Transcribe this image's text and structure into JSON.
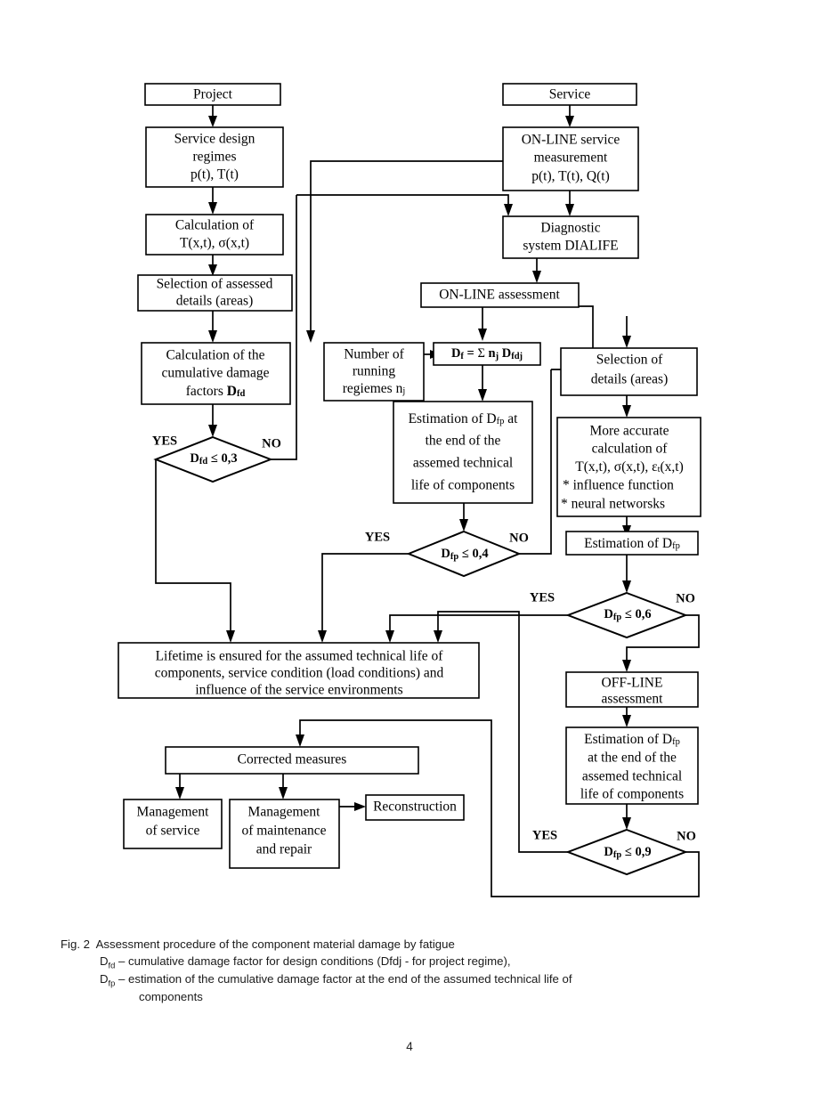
{
  "figure": {
    "page_number": "4",
    "caption_prefix": "Fig. 2",
    "caption_title": "Assessment procedure of the component material damage by fatigue",
    "legend_line_1_symbol": "Dfd",
    "legend_line_1_text": "– cumulative damage factor for design conditions (Dfdj - for project regime),",
    "legend_line_2_symbol": "Dfp",
    "legend_line_2_text": "– estimation of the cumulative damage factor at the end of the assumed technical life of",
    "legend_line_2_cont": "components"
  },
  "nodes": {
    "project": "Project",
    "service": "Service",
    "service_design_regimes_l1": "Service design",
    "service_design_regimes_l2": "regimes",
    "service_design_regimes_l3": "p(t), T(t)",
    "online_measurement_l1": "ON-LINE service",
    "online_measurement_l2": "measurement",
    "online_measurement_l3": "p(t), T(t), Q(t)",
    "calculation_l1": "Calculation of",
    "calculation_l2": "T(x,t), σ(x,t)",
    "diagnostic_l1": "Diagnostic",
    "diagnostic_l2": "system DIALIFE",
    "selection_assessed_l1": "Selection of assessed",
    "selection_assessed_l2": "details (areas)",
    "online_assessment": "ON-LINE assessment",
    "cumulative_l1": "Calculation of the",
    "cumulative_l2": "cumulative damage",
    "cumulative_l3": "factors",
    "cumulative_l3_sym": "Dfd",
    "running_regimes_l1": "Number of",
    "running_regimes_l2": "running",
    "running_regimes_l3": "regiemes",
    "running_regimes_l3_sym": "nj",
    "df_sum": "Df = Σ nj Dfdj",
    "selection_details_l1": "Selection of",
    "selection_details_l2": "details (areas)",
    "estimation_dfp_end_l1": "Estimation of Dfp at",
    "estimation_dfp_end_l2": "the end of the",
    "estimation_dfp_end_l3": "assemed technical",
    "estimation_dfp_end_l4": "life of components",
    "more_accurate_l1": "More accurate",
    "more_accurate_l2": "calculation of",
    "more_accurate_l3": "T(x,t), σ(x,t), εt(x,t)",
    "more_accurate_l4": "*  influence function",
    "more_accurate_l5": "* neural networsks",
    "estimation_dfp": "Estimation of Dfp",
    "lifetime_l1": "Lifetime is ensured for the assumed technical life of",
    "lifetime_l2": "components, service condition (load conditions) and",
    "lifetime_l3": "influence of the service environments",
    "offline_l1": "OFF-LINE",
    "offline_l2": "assessment",
    "estimation_dfp_off_l1": "Estimation of  Dfp",
    "estimation_dfp_off_l2": "at the end of the",
    "estimation_dfp_off_l3": "assemed technical",
    "estimation_dfp_off_l4": "life of components",
    "corrected_measures": "Corrected measures",
    "management_service_l1": "Management",
    "management_service_l2": "of service",
    "management_maint_l1": "Management",
    "management_maint_l2": "of maintenance",
    "management_maint_l3": "and repair",
    "reconstruction": "Reconstruction"
  },
  "decisions": {
    "d_fd_03_sym": "Dfd",
    "d_fd_03_rel": " ≤ 0,3",
    "d_fp_04_sym": "Dfp",
    "d_fp_04_rel": " ≤ 0,4",
    "d_fp_06_sym": "Dfp",
    "d_fp_06_rel": " ≤ 0,6",
    "d_fp_09_sym": "Dfp",
    "d_fp_09_rel": " ≤ 0,9"
  },
  "branch_labels": {
    "yes": "YES",
    "no": "NO"
  },
  "colors": {
    "stroke": "#000000",
    "fill": "#ffffff",
    "text": "#000000"
  }
}
